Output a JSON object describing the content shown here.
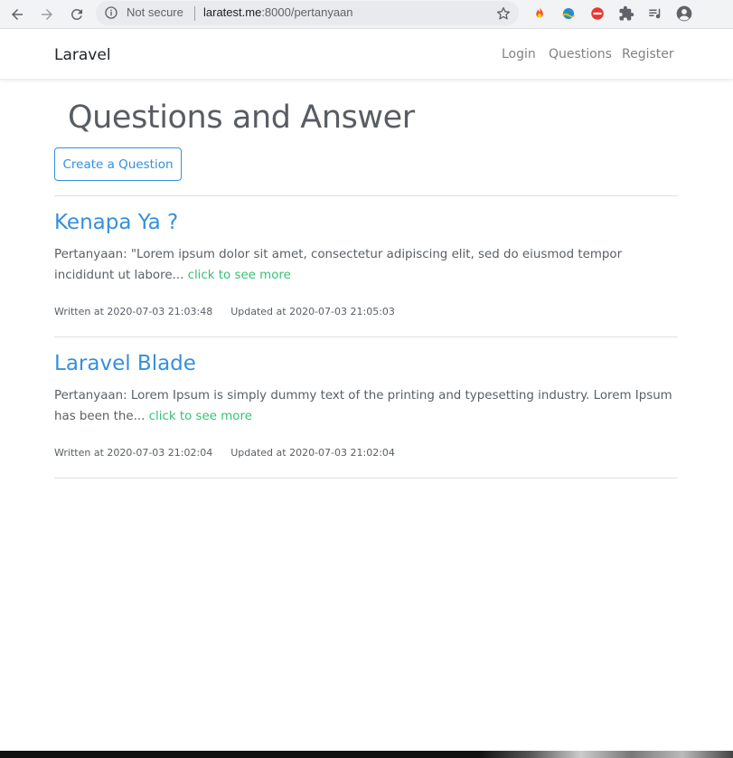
{
  "browser": {
    "security_label": "Not secure",
    "url_host": "laratest.me",
    "url_path": ":8000/pertanyaan",
    "icons": [
      "back-icon",
      "forward-icon",
      "reload-icon",
      "info-icon",
      "star-icon",
      "extension-fire-icon",
      "extension-globe-icon",
      "extension-block-icon",
      "puzzle-icon",
      "media-queue-icon",
      "account-icon"
    ]
  },
  "navbar": {
    "brand": "Laravel",
    "links": [
      {
        "label": "Login"
      },
      {
        "label": "Questions"
      },
      {
        "label": "Register"
      }
    ]
  },
  "main": {
    "title": "Questions and Answer",
    "create_button": "Create a Question",
    "questions": [
      {
        "title": "Kenapa Ya ?",
        "body": "Pertanyaan: \"Lorem ipsum dolor sit amet, consectetur adipiscing elit, sed do eiusmod tempor incididunt ut labore...",
        "more_link": "click to see more",
        "written": "Written at 2020-07-03 21:03:48",
        "updated": "Updated at 2020-07-03 21:05:03"
      },
      {
        "title": "Laravel Blade",
        "body": "Pertanyaan: Lorem Ipsum is simply dummy text of the printing and typesetting industry. Lorem Ipsum has been the...",
        "more_link": "click to see more",
        "written": "Written at 2020-07-03 21:02:04",
        "updated": "Updated at 2020-07-03 21:02:04"
      }
    ]
  },
  "colors": {
    "primary": "#3490dc",
    "success": "#38c172",
    "muted_text": "#5a6066"
  }
}
